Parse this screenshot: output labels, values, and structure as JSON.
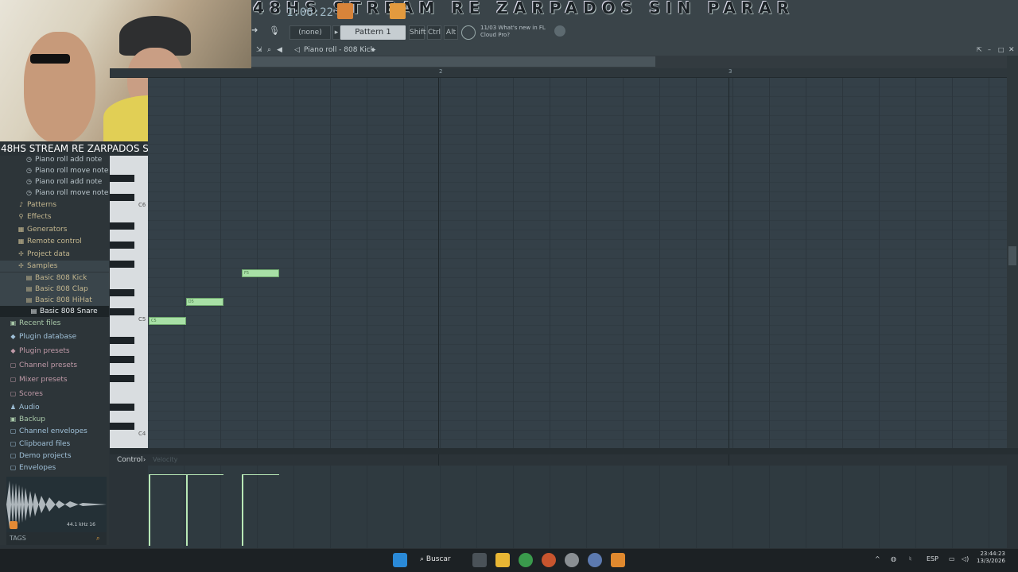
{
  "overlay": {
    "marquee": "48HS STREAM RE ZARPADOS SIN PARAR",
    "title": "48HS STREAM RE ZARPADOS SIN PARAR"
  },
  "toolbar": {
    "timecode": "1:06:22",
    "none_select": "(none)",
    "pattern": "Pattern 1",
    "shift": "Shift",
    "ctrl": "Ctrl",
    "alt": "Alt",
    "news_index": "11/03",
    "news_text_1": "What's new in FL",
    "news_text_2": "Cloud Pro?"
  },
  "piano_roll": {
    "title": "Piano roll - 808 Kick",
    "ruler": [
      "2",
      "3"
    ],
    "octaves": [
      "C6",
      "C5",
      "C4"
    ],
    "notes": [
      {
        "label": "C5",
        "start_step": 0,
        "length_steps": 4,
        "pitch": "C5"
      },
      {
        "label": "D5",
        "start_step": 4,
        "length_steps": 4,
        "pitch": "D5"
      },
      {
        "label": "F5",
        "start_step": 10,
        "length_steps": 4,
        "pitch": "F5"
      }
    ],
    "control_label": "Control",
    "control_sub": "Velocity"
  },
  "browser": {
    "undo_items": [
      "Piano roll add note",
      "Piano roll move note",
      "Piano roll add note",
      "Piano roll move note"
    ],
    "categories": [
      "Patterns",
      "Effects",
      "Generators",
      "Remote control",
      "Project data",
      "Samples"
    ],
    "samples": [
      "Basic 808 Kick",
      "Basic 808 Clap",
      "Basic 808 HiHat",
      "Basic 808 Snare"
    ],
    "roots": [
      "Recent files",
      "Plugin database",
      "Plugin presets",
      "Channel presets",
      "Mixer presets",
      "Scores",
      "Audio",
      "Backup",
      "Channel envelopes",
      "Clipboard files",
      "Demo projects",
      "Envelopes"
    ],
    "sample_info": "44.1 kHz 16",
    "tags": "TAGS"
  },
  "taskbar": {
    "search": "Buscar",
    "lang": "ESP",
    "time": "23:44:23",
    "date": "13/3/2026"
  }
}
